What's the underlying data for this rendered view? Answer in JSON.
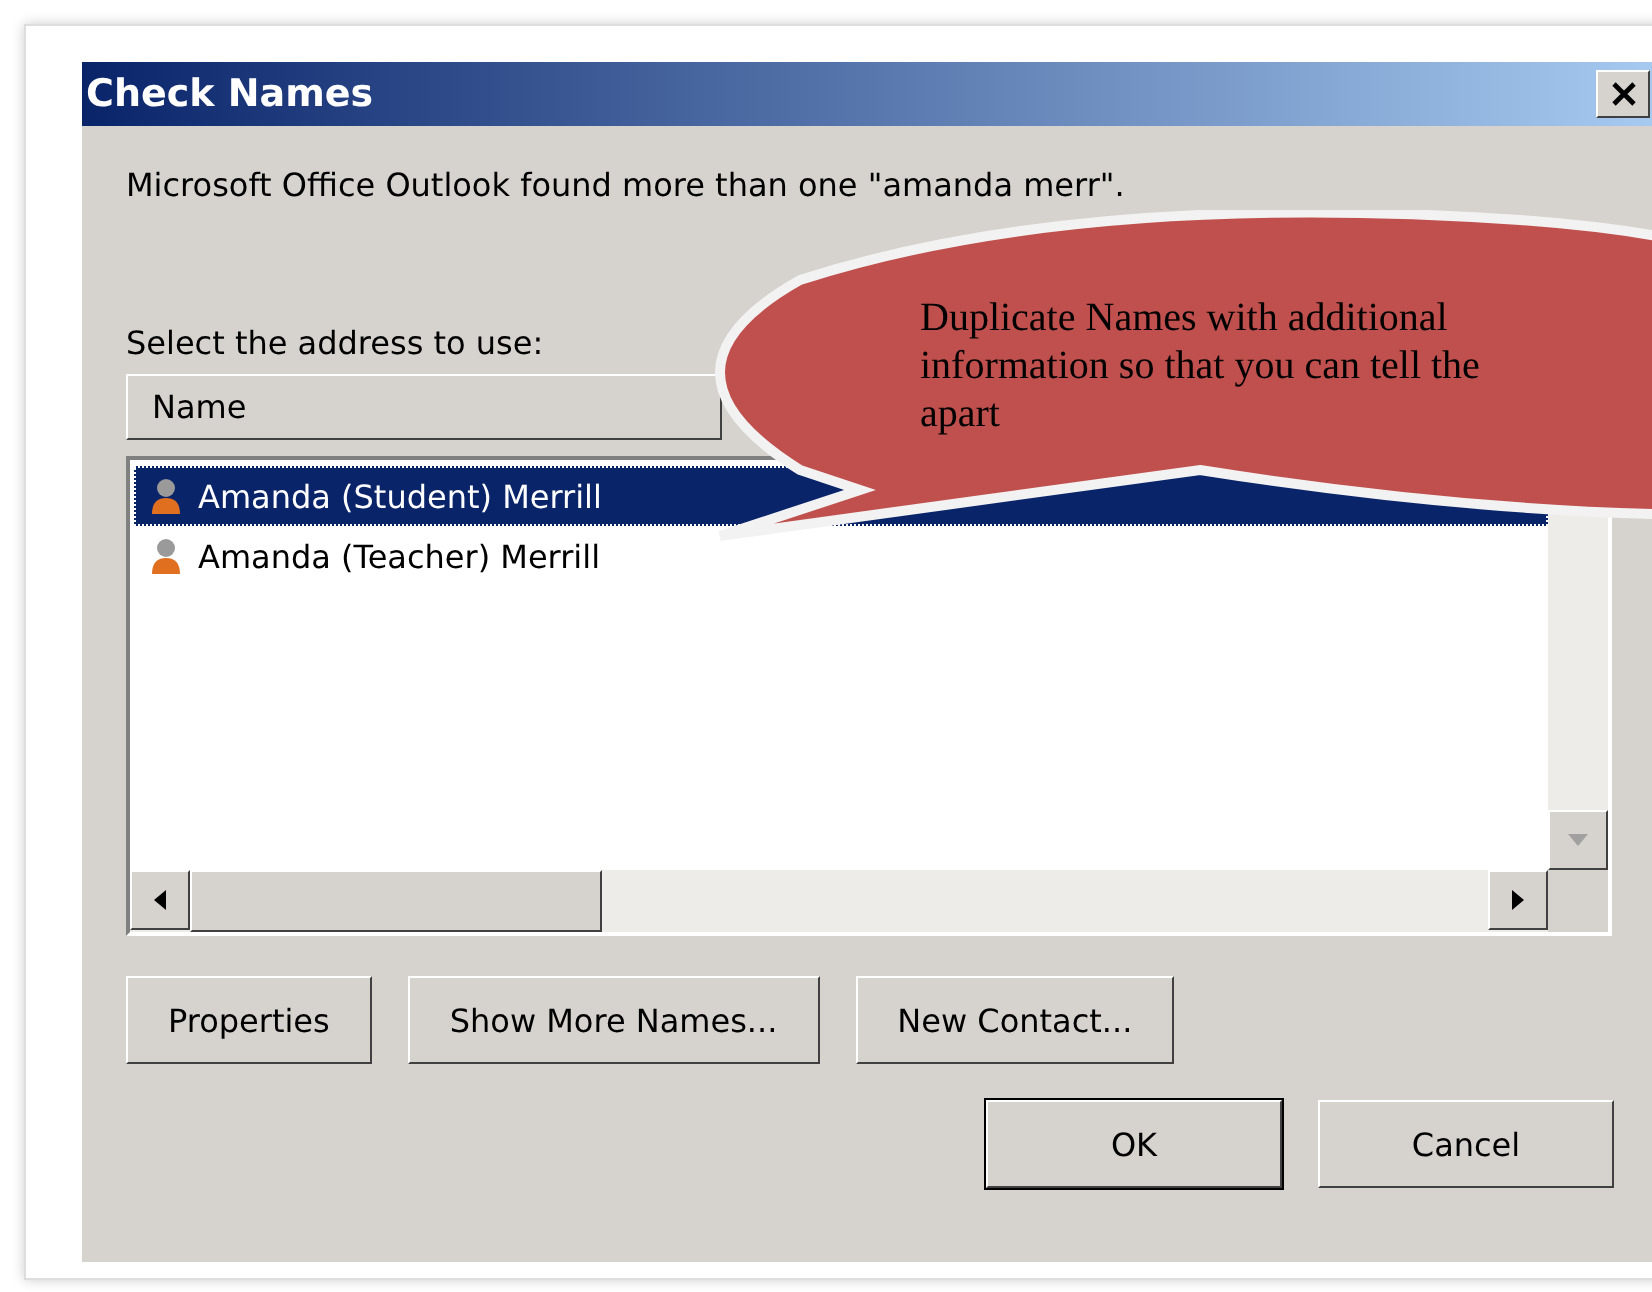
{
  "window": {
    "title": "Check Names"
  },
  "message": "Microsoft Office Outlook found more than one \"amanda merr\".",
  "prompt": "Select the address to use:",
  "table": {
    "columns": [
      "Name"
    ],
    "rows": [
      {
        "name": "Amanda (Student) Merrill",
        "selected": true
      },
      {
        "name": "Amanda (Teacher) Merrill",
        "selected": false
      }
    ]
  },
  "buttons": [
    {
      "label": "Properties"
    },
    {
      "label": "Show More Names..."
    },
    {
      "label": "New Contact..."
    }
  ],
  "dialog_buttons": [
    {
      "label": "OK",
      "kind": "default"
    },
    {
      "label": "Cancel",
      "kind": "normal"
    }
  ],
  "callout": {
    "lines": [
      "Duplicate Names with additional",
      "information so that you can tell the",
      "apart"
    ]
  }
}
